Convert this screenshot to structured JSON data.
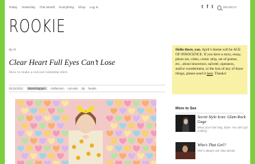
{
  "nav": {
    "items": [
      "Today",
      "Yesterday",
      "This Month",
      "Everything",
      "Shop",
      "Log In"
    ]
  },
  "social": {
    "tumblr": "t",
    "facebook": "f",
    "twitter": "t"
  },
  "search": {
    "placeholder": "SEARCH"
  },
  "logo": "ROOKIE",
  "article": {
    "byline": "By M",
    "title": "Clear Heart Full Eyes Can’t Lose",
    "subtitle": "How to make a cut-out-valentine shirt.",
    "date": "02/11/2012",
    "category": "Make/Happen",
    "tags": [
      "craftenoon",
      "cut-outs",
      "diy",
      "hearts"
    ]
  },
  "sidebar": {
    "greeting": "Hello there, you.",
    "body_before_link": " April’s theme will be AGE OF INNOCENCE. If you have a story, essay, photo set, video, comic strip, set of poems, etc., about innocence, naïveté, openness, and/or wonderment, or the loss of any of those things, please send it ",
    "link": "here",
    "body_after_link": ". Thanks!",
    "more_title": "More to See",
    "stories": [
      {
        "title": "Secret Style Icon: Glam Rock Gage",
        "subtitle": "Wear your hair long, babe. You ain't got nothing"
      },
      {
        "title": "Who's That Girl?",
        "subtitle": "She's always one step ahead."
      }
    ]
  },
  "colors": {
    "background": "#7ccf3f",
    "highlight": "#f9f1a6"
  }
}
